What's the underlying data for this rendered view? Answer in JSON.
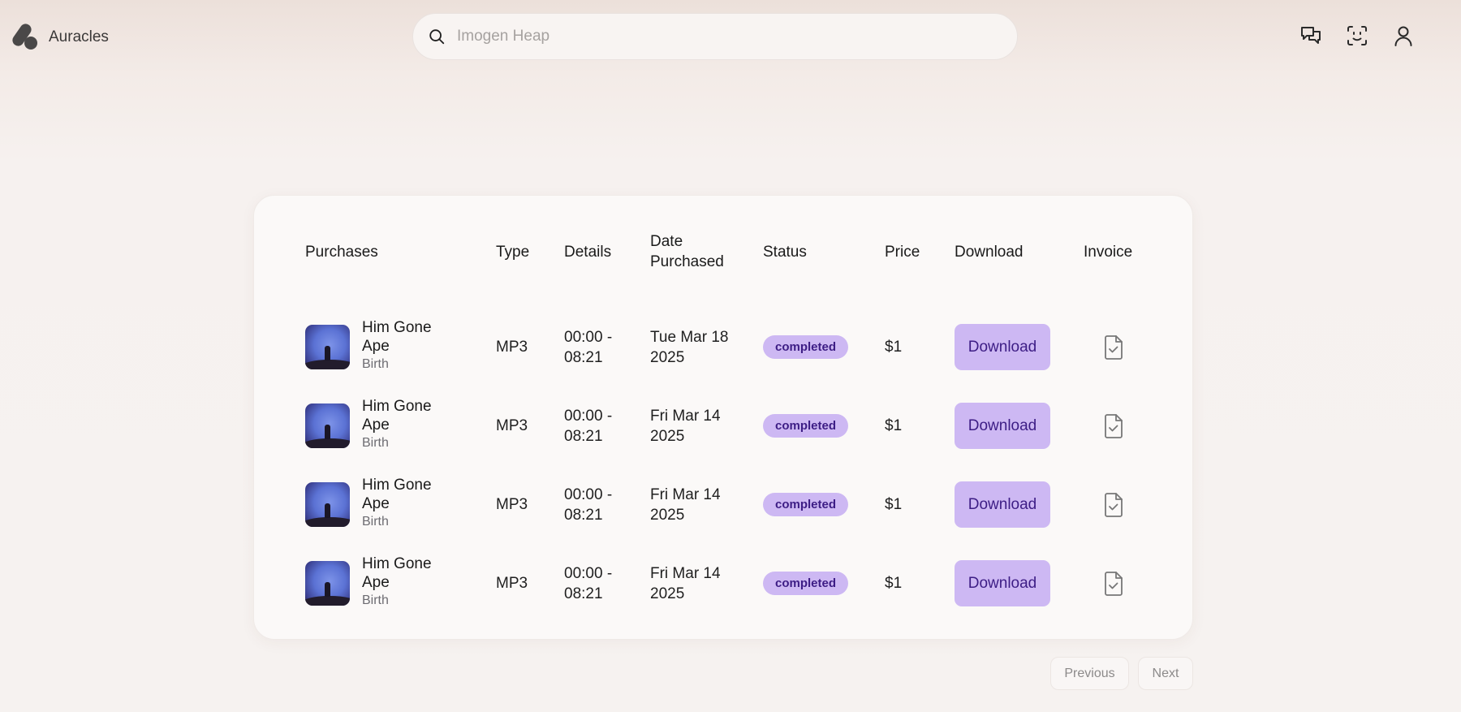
{
  "app": {
    "name": "Auracles"
  },
  "search": {
    "placeholder": "Imogen Heap",
    "value": ""
  },
  "header_icons": [
    "chat-icon",
    "face-scan-icon",
    "user-icon"
  ],
  "table": {
    "columns": [
      "Purchases",
      "Type",
      "Details",
      "Date Purchased",
      "Status",
      "Price",
      "Download",
      "Invoice"
    ],
    "column_lines": {
      "date": [
        "Date",
        "Purchased"
      ]
    },
    "rows": [
      {
        "title": "Him Gone Ape",
        "album": "Birth",
        "type": "MP3",
        "details": [
          "00:00 -",
          "08:21"
        ],
        "date": [
          "Tue Mar 18",
          "2025"
        ],
        "status": "completed",
        "price": "$1",
        "download_label": "Download",
        "invoice_icon": "file-check-icon"
      },
      {
        "title": "Him Gone Ape",
        "album": "Birth",
        "type": "MP3",
        "details": [
          "00:00 -",
          "08:21"
        ],
        "date": [
          "Fri Mar 14",
          "2025"
        ],
        "status": "completed",
        "price": "$1",
        "download_label": "Download",
        "invoice_icon": "file-check-icon"
      },
      {
        "title": "Him Gone Ape",
        "album": "Birth",
        "type": "MP3",
        "details": [
          "00:00 -",
          "08:21"
        ],
        "date": [
          "Fri Mar 14",
          "2025"
        ],
        "status": "completed",
        "price": "$1",
        "download_label": "Download",
        "invoice_icon": "file-check-icon"
      },
      {
        "title": "Him Gone Ape",
        "album": "Birth",
        "type": "MP3",
        "details": [
          "00:00 -",
          "08:21"
        ],
        "date": [
          "Fri Mar 14",
          "2025"
        ],
        "status": "completed",
        "price": "$1",
        "download_label": "Download",
        "invoice_icon": "file-check-icon"
      }
    ]
  },
  "pagination": {
    "previous_label": "Previous",
    "next_label": "Next"
  },
  "colors": {
    "accent_bg": "#cdb8f3",
    "accent_text": "#3d1d85",
    "card_bg": "#fbf9f8"
  }
}
